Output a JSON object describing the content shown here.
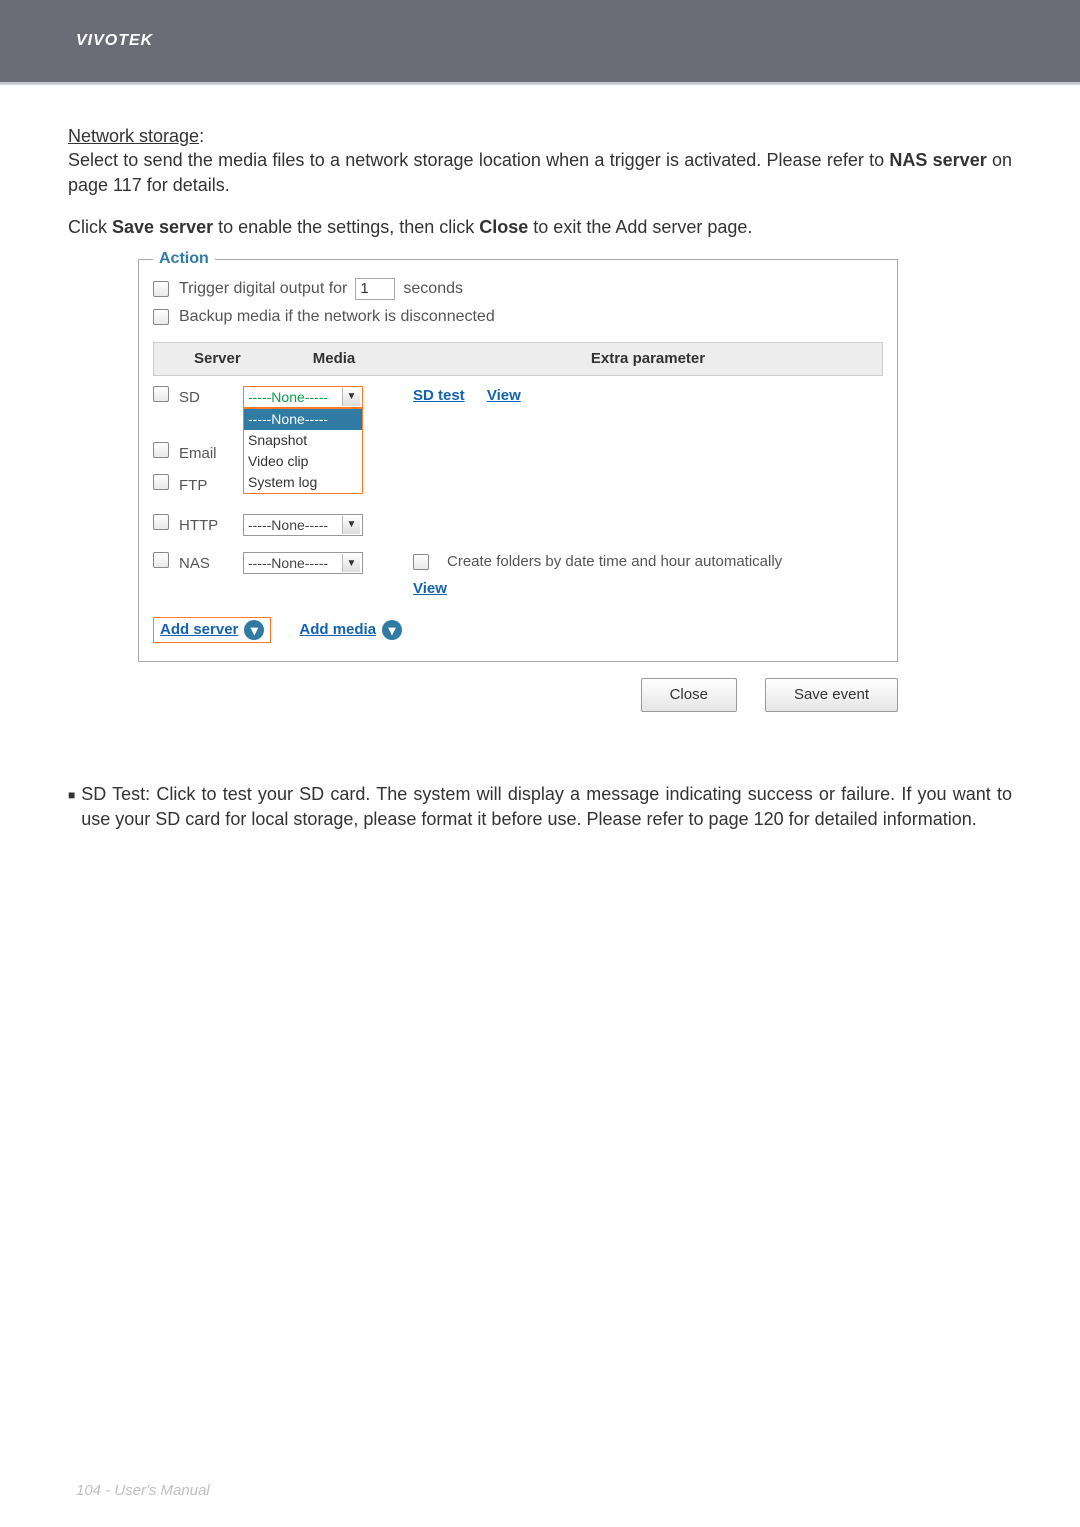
{
  "header": {
    "brand": "VIVOTEK"
  },
  "intro": {
    "title": "Network storage",
    "colon": ":",
    "line1": "Select to send the media files to a network storage location when a trigger is activated. Please refer to ",
    "bold1": "NAS server",
    "line1_cont": " on page 117 for details."
  },
  "click_line": {
    "pre": "Click ",
    "b1": "Save server",
    "mid": " to enable the settings, then click ",
    "b2": "Close",
    "post": " to exit the Add server page."
  },
  "action": {
    "legend": "Action",
    "trigger_label_pre": "Trigger digital output for",
    "trigger_value": "1",
    "trigger_label_post": "seconds",
    "backup_label": "Backup media if the network is disconnected",
    "headers": {
      "server": "Server",
      "media": "Media",
      "extra": "Extra parameter"
    },
    "rows": {
      "sd": {
        "label": "SD",
        "media_selected": "-----None-----",
        "extra_link1": "SD test",
        "extra_link2": "View"
      },
      "email": {
        "label": "Email"
      },
      "ftp": {
        "label": "FTP"
      },
      "http": {
        "label": "HTTP",
        "media_selected": "-----None-----"
      },
      "nas": {
        "label": "NAS",
        "media_selected": "-----None-----",
        "create_label": "Create folders by date time and hour automatically",
        "view": "View"
      }
    },
    "dropdown_options": {
      "none": "-----None-----",
      "snapshot": "Snapshot",
      "videoclip": "Video clip",
      "systemlog": "System log"
    },
    "add_server": "Add server",
    "add_media": "Add media"
  },
  "buttons": {
    "close": "Close",
    "save": "Save event"
  },
  "sd_test": {
    "text": "SD Test: Click to test your SD card. The system will display a message indicating success or failure. If you want to use your SD card for local storage, please format it before use. Please refer to page 120 for detailed information."
  },
  "footer": {
    "text": "104 - User's Manual"
  }
}
